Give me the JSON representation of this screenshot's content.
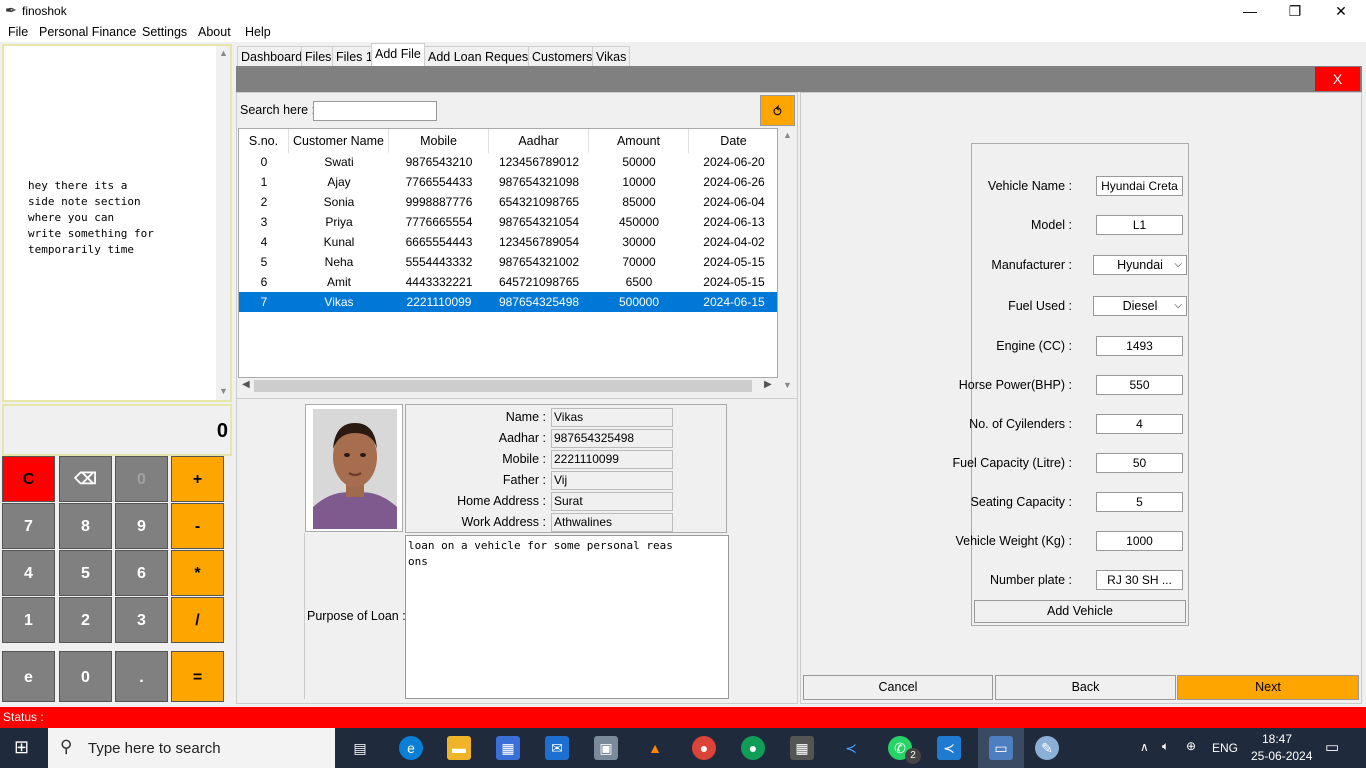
{
  "window": {
    "title": "finoshok",
    "minimize": "—",
    "maximize": "❐",
    "close": "✕"
  },
  "menu": [
    "File",
    "Personal Finance",
    "Settings",
    "About",
    "Help"
  ],
  "note": "hey there its a\nside note section\nwhere you can\nwrite something for\ntemporarily time",
  "calculator": {
    "display": "0",
    "buttons": [
      [
        "C",
        "⌫",
        "0",
        "+"
      ],
      [
        "7",
        "8",
        "9",
        "-"
      ],
      [
        "4",
        "5",
        "6",
        "*"
      ],
      [
        "1",
        "2",
        "3",
        "/"
      ],
      [
        "e",
        "0",
        ".",
        "="
      ]
    ]
  },
  "tabs": [
    "Dashboard",
    "Files",
    "Files 1",
    "Add File",
    "Add Loan Request",
    "Customers",
    "Vikas"
  ],
  "active_tab": "Add File",
  "close_label": "X",
  "search": {
    "label": "Search here :",
    "value": "",
    "refresh_icon": "⥀"
  },
  "table": {
    "columns": [
      "S.no.",
      "Customer Name",
      "Mobile",
      "Aadhar",
      "Amount",
      "Date"
    ],
    "rows": [
      [
        "0",
        "Swati",
        "9876543210",
        "123456789012",
        "50000",
        "2024-06-20"
      ],
      [
        "1",
        "Ajay",
        "7766554433",
        "987654321098",
        "10000",
        "2024-06-26"
      ],
      [
        "2",
        "Sonia",
        "9998887776",
        "654321098765",
        "85000",
        "2024-06-04"
      ],
      [
        "3",
        "Priya",
        "7776665554",
        "987654321054",
        "450000",
        "2024-06-13"
      ],
      [
        "4",
        "Kunal",
        "6665554443",
        "123456789054",
        "30000",
        "2024-04-02"
      ],
      [
        "5",
        "Neha",
        "5554443332",
        "987654321002",
        "70000",
        "2024-05-15"
      ],
      [
        "6",
        "Amit",
        "4443332221",
        "645721098765",
        "6500",
        "2024-05-15"
      ],
      [
        "7",
        "Vikas",
        "2221110099",
        "987654325498",
        "500000",
        "2024-06-15"
      ]
    ],
    "selected_row": 7
  },
  "customer": {
    "fields": [
      {
        "label": "Name :",
        "value": "Vikas"
      },
      {
        "label": "Aadhar :",
        "value": "987654325498"
      },
      {
        "label": "Mobile :",
        "value": "2221110099"
      },
      {
        "label": "Father :",
        "value": "Vij"
      },
      {
        "label": "Home Address :",
        "value": "Surat"
      },
      {
        "label": "Work Address :",
        "value": "Athwalines"
      }
    ],
    "purpose_label": "Purpose of Loan :",
    "purpose": "loan on a vehicle for some personal reas\nons"
  },
  "vehicle": {
    "fields": [
      {
        "label": "Vehicle Name :",
        "value": "Hyundai Creta",
        "type": "input"
      },
      {
        "label": "Model :",
        "value": "L1",
        "type": "input"
      },
      {
        "label": "Manufacturer :",
        "value": "Hyundai",
        "type": "select"
      },
      {
        "label": "Fuel Used :",
        "value": "Diesel",
        "type": "select"
      },
      {
        "label": "Engine (CC) :",
        "value": "1493",
        "type": "input"
      },
      {
        "label": "Horse Power(BHP) :",
        "value": "550",
        "type": "input"
      },
      {
        "label": "No. of Cyilenders :",
        "value": "4",
        "type": "input"
      },
      {
        "label": "Fuel Capacity (Litre) :",
        "value": "50",
        "type": "input"
      },
      {
        "label": "Seating Capacity :",
        "value": "5",
        "type": "input"
      },
      {
        "label": "Vehicle Weight (Kg) :",
        "value": "1000",
        "type": "input"
      },
      {
        "label": "Number plate :",
        "value": "RJ 30 SH ...",
        "type": "input"
      }
    ],
    "add_button": "Add Vehicle"
  },
  "nav": {
    "cancel": "Cancel",
    "back": "Back",
    "next": "Next"
  },
  "status": "Status :",
  "taskbar": {
    "search_placeholder": "Type here to search",
    "lang": "ENG",
    "time": "18:47",
    "date": "25-06-2024",
    "whatsapp_badge": "2"
  },
  "colors": {
    "accent": "#ffa500",
    "danger": "#ff0000",
    "selection": "#0078d7"
  }
}
